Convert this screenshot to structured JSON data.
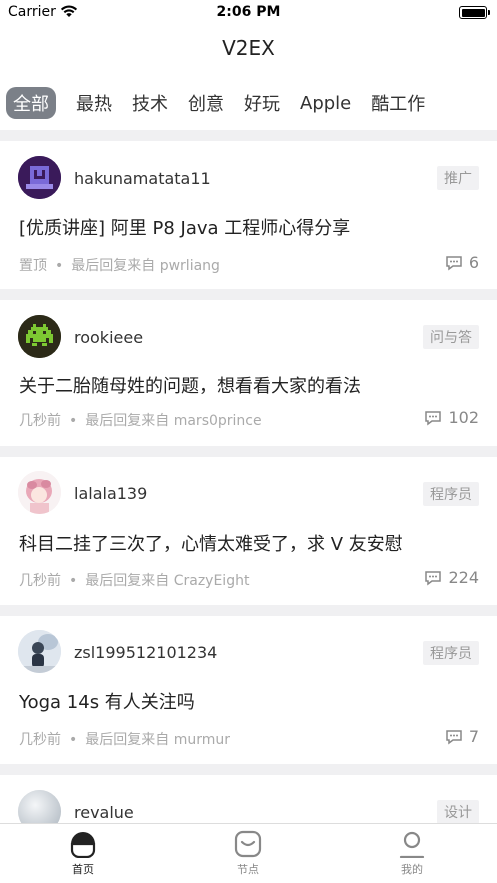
{
  "status_bar": {
    "carrier": "Carrier",
    "time": "2:06 PM"
  },
  "nav": {
    "title": "V2EX"
  },
  "tabs": [
    {
      "label": "全部",
      "active": true
    },
    {
      "label": "最热"
    },
    {
      "label": "技术"
    },
    {
      "label": "创意"
    },
    {
      "label": "好玩"
    },
    {
      "label": "Apple"
    },
    {
      "label": "酷工作"
    }
  ],
  "topics": [
    {
      "username": "hakunamatata11",
      "node": "推广",
      "title": "[优质讲座] 阿里 P8 Java 工程师心得分享",
      "time": "置顶",
      "last_reply": "最后回复来自 pwrliang",
      "replies": "6",
      "avatar": "purple-pixel-avatar"
    },
    {
      "username": "rookieee",
      "node": "问与答",
      "title": "关于二胎随母姓的问题，想看看大家的看法",
      "time": "几秒前",
      "last_reply": "最后回复来自 mars0prince",
      "replies": "102",
      "avatar": "space-invader-avatar"
    },
    {
      "username": "lalala139",
      "node": "程序员",
      "title": "科目二挂了三次了，心情太难受了，求 V 友安慰",
      "time": "几秒前",
      "last_reply": "最后回复来自 CrazyEight",
      "replies": "224",
      "avatar": "anime-girl-avatar"
    },
    {
      "username": "zsl199512101234",
      "node": "程序员",
      "title": "Yoga 14s 有人关注吗",
      "time": "几秒前",
      "last_reply": "最后回复来自 murmur",
      "replies": "7",
      "avatar": "photo-avatar"
    },
    {
      "username": "revalue",
      "node": "设计",
      "avatar": "grey-sphere-avatar"
    }
  ],
  "tab_bar": [
    {
      "label": "首页",
      "icon": "home-icon",
      "active": true
    },
    {
      "label": "节点",
      "icon": "node-icon"
    },
    {
      "label": "我的",
      "icon": "profile-icon"
    }
  ],
  "colors": {
    "accent": "#7b8088",
    "divider": "#f0f0f2",
    "tag_bg": "#f1f1f3",
    "muted": "#aaaaaa"
  }
}
